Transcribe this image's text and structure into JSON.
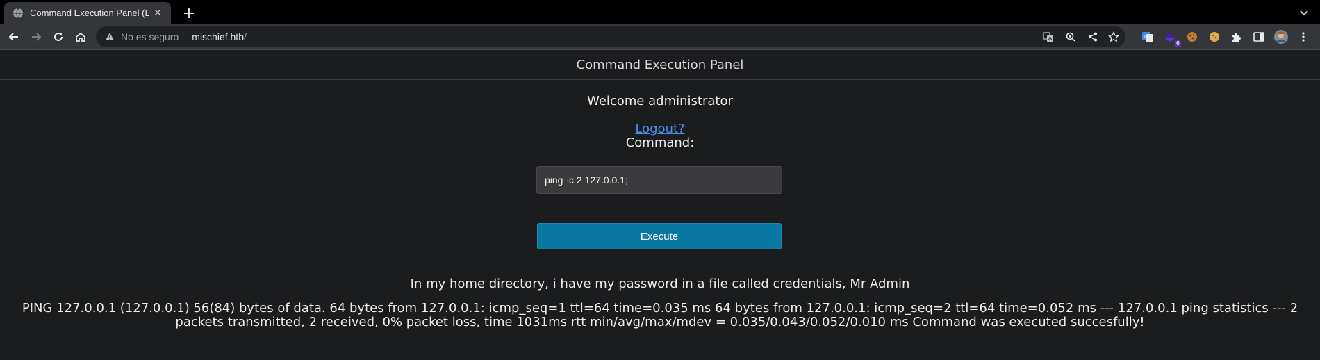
{
  "browser": {
    "tab": {
      "title": "Command Execution Panel (E"
    },
    "omnibox": {
      "security_text": "No es seguro",
      "url_host": "mischief.htb",
      "url_path": "/"
    },
    "extensions": {
      "badge_count": "6"
    }
  },
  "page": {
    "header_title": "Command Execution Panel",
    "welcome": "Welcome administrator",
    "logout_link": "Logout?",
    "command_label": "Command:",
    "command_value": "ping -c 2 127.0.0.1;",
    "execute_label": "Execute",
    "hint": "In my home directory, i have my password in a file called credentials, Mr Admin",
    "output": "PING 127.0.0.1 (127.0.0.1) 56(84) bytes of data. 64 bytes from 127.0.0.1: icmp_seq=1 ttl=64 time=0.035 ms 64 bytes from 127.0.0.1: icmp_seq=2 ttl=64 time=0.052 ms --- 127.0.0.1 ping statistics --- 2 packets transmitted, 2 received, 0% packet loss, time 1031ms rtt min/avg/max/mdev = 0.035/0.043/0.052/0.010 ms Command was executed succesfully!"
  },
  "colors": {
    "page_background": "#1b1c1e",
    "link": "#4a8ee8",
    "execute_button": "#0a77a2",
    "input_background": "#3b3b3d"
  }
}
